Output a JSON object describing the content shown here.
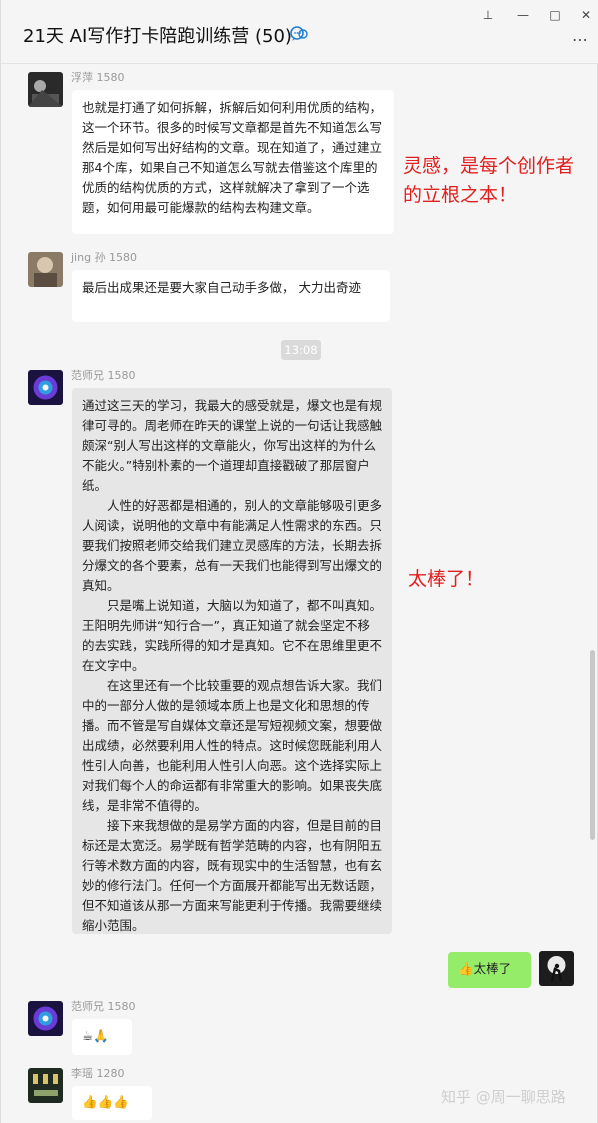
{
  "window": {
    "title": "21天 AI写作打卡陪跑训练营 (50)",
    "controls": {
      "pin": "⊥",
      "minimize": "—",
      "maximize": "□",
      "close": "✕"
    },
    "more": "⋯"
  },
  "messages": [
    {
      "sender": "浮萍 1580",
      "text": "也就是打通了如何拆解，拆解后如何利用优质的结构，这一个环节。很多的时候写文章都是首先不知道怎么写然后是如何写出好结构的文章。现在知道了，通过建立那4个库，如果自己不知道怎么写就去借鉴这个库里的优质的结构优质的方式，这样就解决了拿到了一个选题，如何用最可能爆款的结构去构建文章。"
    },
    {
      "sender": "jing 孙 1580",
      "text": "最后出成果还是要大家自己动手多做， 大力出奇迹"
    },
    {
      "sender": "范师兄 1580",
      "paragraphs": [
        "通过这三天的学习，我最大的感受就是，爆文也是有规律可寻的。周老师在昨天的课堂上说的一句话让我感触颇深“别人写出这样的文章能火，你写出这样的为什么不能火。”特别朴素的一个道理却直接戳破了那层窗户纸。",
        "人性的好恶都是相通的，别人的文章能够吸引更多人阅读，说明他的文章中有能满足人性需求的东西。只要我们按照老师交给我们建立灵感库的方法，长期去拆分爆文的各个要素，总有一天我们也能得到写出爆文的真知。",
        "只是嘴上说知道，大脑以为知道了，都不叫真知。王阳明先师讲“知行合一”，真正知道了就会坚定不移的去实践，实践所得的知才是真知。它不在思维里更不在文字中。",
        "在这里还有一个比较重要的观点想告诉大家。我们中的一部分人做的是领域本质上也是文化和思想的传播。而不管是写自媒体文章还是写短视频文案，想要做出成绩，必然要利用人性的特点。这时候您既能利用人性引人向善，也能利用人性引人向恶。这个选择实际上对我们每个人的命运都有非常重大的影响。如果丧失底线，是非常不值得的。",
        "接下来我想做的是易学方面的内容，但是目前的目标还是太宽泛。易学既有哲学范畴的内容，也有阴阳五行等术数方面的内容，既有现实中的生活智慧，也有玄妙的修行法门。任何一个方面展开都能写出无数话题，但不知道该从那一方面来写能更利于传播。我需要继续缩小范围。"
      ]
    },
    {
      "sender": "me",
      "text": "👍太棒了"
    },
    {
      "sender": "范师兄 1580",
      "text": "☕🙏"
    },
    {
      "sender": "李瑶  1280",
      "text": "👍👍👍"
    }
  ],
  "timestamp": "13:08",
  "annotations": {
    "first": "灵感，是每个创作者的立根之本！",
    "second": "太棒了！"
  },
  "watermark": "知乎 @周一聊思路",
  "colors": {
    "bubble_white": "#ffffff",
    "bubble_grey": "#e6e6e6",
    "bubble_green": "#95ec69",
    "annotation_red": "#e0201f",
    "background": "#f5f5f5"
  }
}
